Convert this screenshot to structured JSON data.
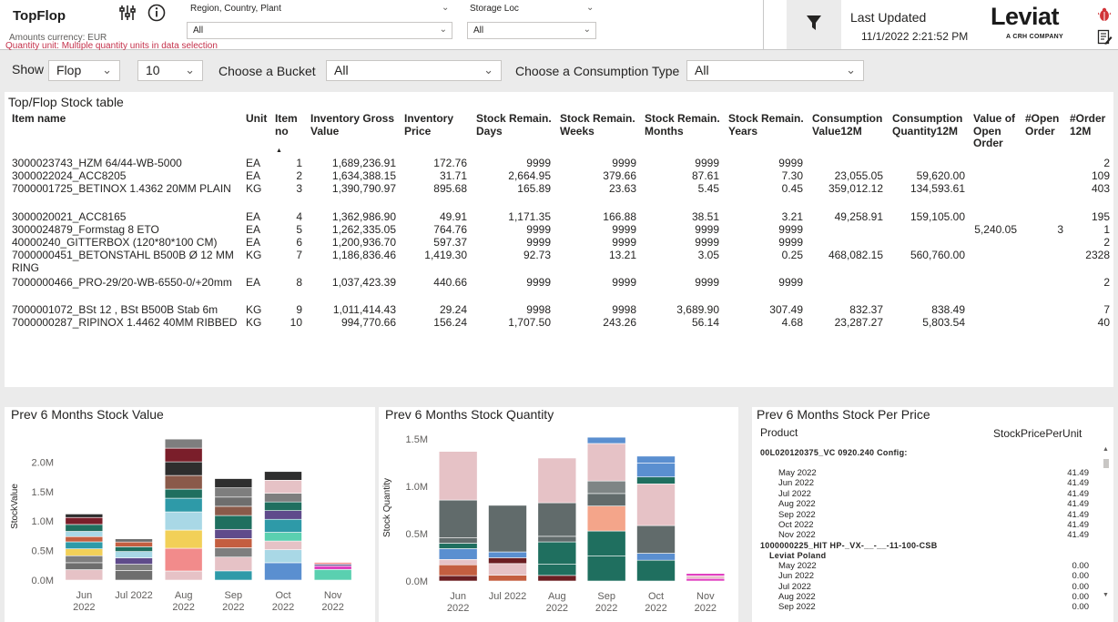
{
  "header": {
    "title": "TopFlop",
    "amounts_currency": "Amounts currency: EUR",
    "quantity_unit": "Quantity unit: Multiple quantity units in data selection",
    "slicer_region": {
      "label": "Region, Country, Plant",
      "value": "All"
    },
    "slicer_storage": {
      "label": "Storage Loc",
      "value": "All"
    },
    "last_updated_label": "Last Updated",
    "last_updated_value": "11/1/2022 2:21:52 PM",
    "logo_text": "Leviat",
    "logo_sub": "A CRH COMPANY",
    "brand_color": "#1b1b1b"
  },
  "filters": {
    "show_label": "Show",
    "show_value": "Flop",
    "count_value": "10",
    "bucket_label": "Choose a Bucket",
    "bucket_value": "All",
    "consumption_label": "Choose a Consumption Type",
    "consumption_value": "All"
  },
  "table": {
    "title": "Top/Flop Stock table",
    "headers": {
      "item_name": "Item name",
      "unit": "Unit",
      "item_no": "Item no",
      "inv_gross": "Inventory Gross Value",
      "inv_price": "Inventory Price",
      "sr_days": "Stock Remain. Days",
      "sr_weeks": "Stock Remain. Weeks",
      "sr_months": "Stock Remain. Months",
      "sr_years": "Stock Remain. Years",
      "cons_val": "Consumption Value12M",
      "cons_qty": "Consumption Quantity12M",
      "open_order": "Value of Open Order",
      "num_open": "#Open Order",
      "num_order": "#Order 12M"
    },
    "rows": [
      {
        "name": "3000023743_HZM 64/44-WB-5000",
        "unit": "EA",
        "no": "1",
        "gross": "1,689,236.91",
        "price": "172.76",
        "days": "9999",
        "weeks": "9999",
        "months": "9999",
        "years": "9999",
        "cval": "",
        "cqty": "",
        "open": "",
        "nopen": "",
        "norder": "2"
      },
      {
        "name": "3000022024_ACC8205",
        "unit": "EA",
        "no": "2",
        "gross": "1,634,388.15",
        "price": "31.71",
        "days": "2,664.95",
        "weeks": "379.66",
        "months": "87.61",
        "years": "7.30",
        "cval": "23,055.05",
        "cqty": "59,620.00",
        "open": "",
        "nopen": "",
        "norder": "109"
      },
      {
        "name": "7000001725_BETINOX 1.4362 20MM PLAIN",
        "unit": "KG",
        "no": "3",
        "gross": "1,390,790.97",
        "price": "895.68",
        "days": "165.89",
        "weeks": "23.63",
        "months": "5.45",
        "years": "0.45",
        "cval": "359,012.12",
        "cqty": "134,593.61",
        "open": "",
        "nopen": "",
        "norder": "403"
      },
      {
        "name": "3000020021_ACC8165",
        "unit": "EA",
        "no": "4",
        "gross": "1,362,986.90",
        "price": "49.91",
        "days": "1,171.35",
        "weeks": "166.88",
        "months": "38.51",
        "years": "3.21",
        "cval": "49,258.91",
        "cqty": "159,105.00",
        "open": "",
        "nopen": "",
        "norder": "195"
      },
      {
        "name": "3000024879_Formstag 8 ETO",
        "unit": "EA",
        "no": "5",
        "gross": "1,262,335.05",
        "price": "764.76",
        "days": "9999",
        "weeks": "9999",
        "months": "9999",
        "years": "9999",
        "cval": "",
        "cqty": "",
        "open": "5,240.05",
        "nopen": "3",
        "norder": "1"
      },
      {
        "name": "40000240_GITTERBOX (120*80*100 CM)",
        "unit": "EA",
        "no": "6",
        "gross": "1,200,936.70",
        "price": "597.37",
        "days": "9999",
        "weeks": "9999",
        "months": "9999",
        "years": "9999",
        "cval": "",
        "cqty": "",
        "open": "",
        "nopen": "",
        "norder": "2"
      },
      {
        "name": "7000000451_BETONSTAHL B500B Ø 12 MM RING",
        "unit": "KG",
        "no": "7",
        "gross": "1,186,836.46",
        "price": "1,419.30",
        "days": "92.73",
        "weeks": "13.21",
        "months": "3.05",
        "years": "0.25",
        "cval": "468,082.15",
        "cqty": "560,760.00",
        "open": "",
        "nopen": "",
        "norder": "2328"
      },
      {
        "name": "7000000466_PRO-29/20-WB-6550-0/+20mm",
        "unit": "EA",
        "no": "8",
        "gross": "1,037,423.39",
        "price": "440.66",
        "days": "9999",
        "weeks": "9999",
        "months": "9999",
        "years": "9999",
        "cval": "",
        "cqty": "",
        "open": "",
        "nopen": "",
        "norder": "2"
      },
      {
        "name": "7000001072_BSt 12 , BSt B500B Stab 6m",
        "unit": "KG",
        "no": "9",
        "gross": "1,011,414.43",
        "price": "29.24",
        "days": "9998",
        "weeks": "9998",
        "months": "3,689.90",
        "years": "307.49",
        "cval": "832.37",
        "cqty": "838.49",
        "open": "",
        "nopen": "",
        "norder": "7"
      },
      {
        "name": "7000000287_RIPINOX 1.4462 40MM RIBBED",
        "unit": "KG",
        "no": "10",
        "gross": "994,770.66",
        "price": "156.24",
        "days": "1,707.50",
        "weeks": "243.26",
        "months": "56.14",
        "years": "4.68",
        "cval": "23,287.27",
        "cqty": "5,803.54",
        "open": "",
        "nopen": "",
        "norder": "40"
      }
    ]
  },
  "chart_data": [
    {
      "type": "bar",
      "title": "Prev 6 Months Stock Value",
      "xlabel": "",
      "ylabel": "StockValue",
      "ylim": [
        0,
        2500000
      ],
      "yticks": [
        "0.0M",
        "0.5M",
        "1.0M",
        "1.5M",
        "2.0M"
      ],
      "categories": [
        "Jun 2022",
        "Jul 2022",
        "Aug 2022",
        "Sep 2022",
        "Oct 2022",
        "Nov 2022"
      ],
      "totals": [
        1120000,
        700000,
        2390000,
        1720000,
        1840000,
        300000
      ],
      "stacked": true,
      "segment_colors": [
        "#e6c2c6",
        "#6e6e6e",
        "#2e9aa8",
        "#7e7e7e",
        "#c45e40",
        "#a9d8e6",
        "#f2d058",
        "#5f4b8b",
        "#1f6f5f",
        "#8a5a4a",
        "#2e2e2e",
        "#7a1e2a",
        "#f28b8b",
        "#5a8fd0",
        "#e040c0",
        "#5ad0b0"
      ]
    },
    {
      "type": "bar",
      "title": "Prev 6 Months Stock Quantity",
      "xlabel": "",
      "ylabel": "Stock Quantity",
      "ylim": [
        0,
        1550000
      ],
      "yticks": [
        "0.0M",
        "0.5M",
        "1.0M",
        "1.5M"
      ],
      "categories": [
        "Jun 2022",
        "Jul 2022",
        "Aug 2022",
        "Sep 2022",
        "Oct 2022",
        "Nov 2022"
      ],
      "totals": [
        1370000,
        800000,
        1300000,
        1520000,
        1320000,
        80000
      ],
      "stacked": true,
      "segment_colors": [
        "#e6c2c6",
        "#616b6b",
        "#c45e40",
        "#1f6f5f",
        "#f4a58a",
        "#7e8585",
        "#5a8fd0",
        "#e040c0",
        "#6b1e22"
      ]
    }
  ],
  "per_price": {
    "title": "Prev 6 Months Stock Per Price",
    "col_product": "Product",
    "col_value": "StockPricePerUnit",
    "groups": [
      {
        "name": "00L020120375_VC 0920.240 Config:",
        "sub": "",
        "rows": [
          {
            "month": "May 2022",
            "value": "41.49"
          },
          {
            "month": "Jun 2022",
            "value": "41.49"
          },
          {
            "month": "Jul 2022",
            "value": "41.49"
          },
          {
            "month": "Aug 2022",
            "value": "41.49"
          },
          {
            "month": "Sep 2022",
            "value": "41.49"
          },
          {
            "month": "Oct 2022",
            "value": "41.49"
          },
          {
            "month": "Nov 2022",
            "value": "41.49"
          }
        ]
      },
      {
        "name": "1000000225_HIT HP-_VX-__-__-11-100-CSB",
        "sub": "Leviat Poland",
        "rows": [
          {
            "month": "May 2022",
            "value": "0.00"
          },
          {
            "month": "Jun 2022",
            "value": "0.00"
          },
          {
            "month": "Jul 2022",
            "value": "0.00"
          },
          {
            "month": "Aug 2022",
            "value": "0.00"
          },
          {
            "month": "Sep 2022",
            "value": "0.00"
          }
        ]
      }
    ]
  }
}
